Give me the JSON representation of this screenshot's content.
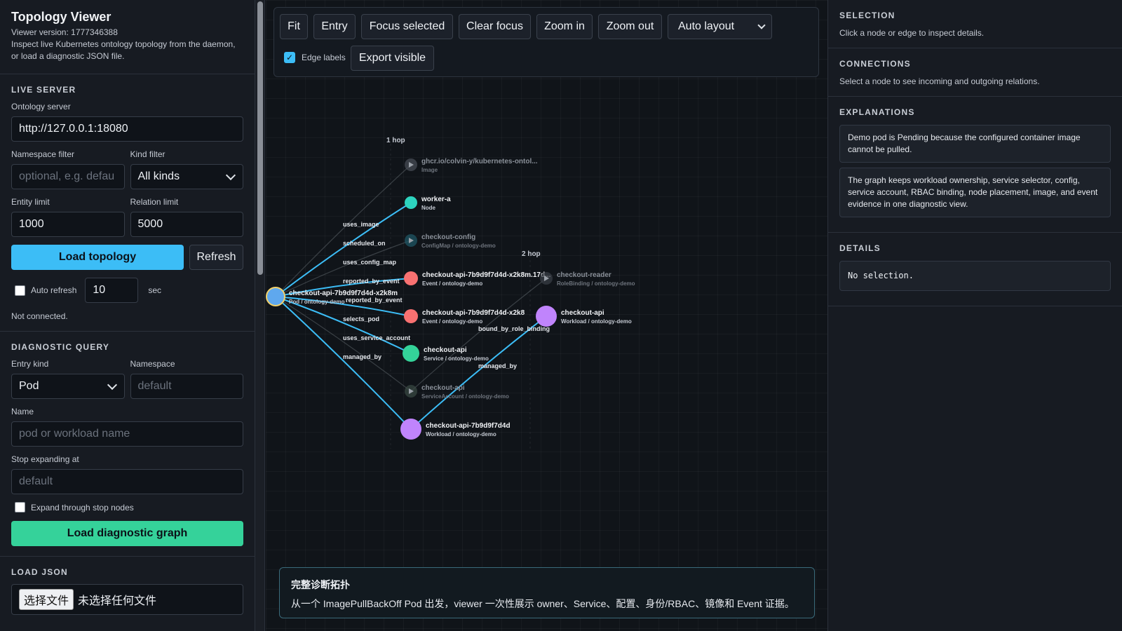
{
  "app": {
    "title": "Topology Viewer",
    "version_line": "Viewer version: 1777346388",
    "description": "Inspect live Kubernetes ontology topology from the daemon, or load a diagnostic JSON file."
  },
  "live_server": {
    "section_title": "LIVE SERVER",
    "server_label": "Ontology server",
    "server_value": "http://127.0.0.1:18080",
    "namespace_label": "Namespace filter",
    "namespace_placeholder": "optional, e.g. defau",
    "kind_label": "Kind filter",
    "kind_value": "All kinds",
    "entity_limit_label": "Entity limit",
    "entity_limit_value": "1000",
    "relation_limit_label": "Relation limit",
    "relation_limit_value": "5000",
    "load_button": "Load topology",
    "refresh_button": "Refresh",
    "auto_refresh_label": "Auto refresh",
    "auto_refresh_value": "10",
    "auto_refresh_unit": "sec",
    "status": "Not connected."
  },
  "diagnostic": {
    "section_title": "DIAGNOSTIC QUERY",
    "entry_kind_label": "Entry kind",
    "entry_kind_value": "Pod",
    "namespace_label": "Namespace",
    "namespace_placeholder": "default",
    "name_label": "Name",
    "name_placeholder": "pod or workload name",
    "stop_label": "Stop expanding at",
    "stop_placeholder": "default",
    "expand_label": "Expand through stop nodes",
    "load_button": "Load diagnostic graph"
  },
  "load_json": {
    "section_title": "LOAD JSON",
    "file_button": "选择文件",
    "file_status": "未选择任何文件"
  },
  "toolbar": {
    "fit": "Fit",
    "entry": "Entry",
    "focus_selected": "Focus selected",
    "clear_focus": "Clear focus",
    "zoom_in": "Zoom in",
    "zoom_out": "Zoom out",
    "layout_value": "Auto layout",
    "edge_labels": "Edge labels",
    "export_visible": "Export visible"
  },
  "graph": {
    "hop_labels": [
      "1 hop",
      "2 hop"
    ],
    "nodes": [
      {
        "id": "pod",
        "name": "checkout-api-7b9d9f7d4d-x2k8m",
        "sub": "Pod / ontology-demo",
        "color": "#5fa8ee",
        "dim": false
      },
      {
        "id": "image",
        "name": "ghcr.io/colvin-y/kubernetes-ontol...",
        "sub": "Image",
        "color": "#4a4f58",
        "dim": true
      },
      {
        "id": "node",
        "name": "worker-a",
        "sub": "Node",
        "color": "#2dd4bf",
        "dim": false
      },
      {
        "id": "cm",
        "name": "checkout-config",
        "sub": "ConfigMap / ontology-demo",
        "color": "#1f5a6a",
        "dim": true
      },
      {
        "id": "ev1",
        "name": "checkout-api-7b9d9f7d4d-x2k8m.17d...",
        "sub": "Event / ontology-demo",
        "color": "#f87171",
        "dim": false
      },
      {
        "id": "ev2",
        "name": "checkout-api-7b9d9f7d4d-x2k8",
        "sub": "Event / ontology-demo",
        "color": "#f87171",
        "dim": false
      },
      {
        "id": "svc",
        "name": "checkout-api",
        "sub": "Service / ontology-demo",
        "color": "#34d399",
        "dim": false
      },
      {
        "id": "sa",
        "name": "checkout-api",
        "sub": "ServiceAccount / ontology-demo",
        "color": "#3a4a44",
        "dim": true
      },
      {
        "id": "rs",
        "name": "checkout-api-7b9d9f7d4d",
        "sub": "Workload / ontology-demo",
        "color": "#c084fc",
        "dim": false
      },
      {
        "id": "rb",
        "name": "checkout-reader",
        "sub": "RoleBinding / ontology-demo",
        "color": "#3b3f47",
        "dim": true
      },
      {
        "id": "deploy",
        "name": "checkout-api",
        "sub": "Workload / ontology-demo",
        "color": "#c084fc",
        "dim": false
      }
    ],
    "edges": [
      {
        "from": "pod",
        "to": "image",
        "label": "uses_image",
        "active": false
      },
      {
        "from": "pod",
        "to": "node",
        "label": "scheduled_on",
        "active": true
      },
      {
        "from": "pod",
        "to": "cm",
        "label": "uses_config_map",
        "active": false
      },
      {
        "from": "pod",
        "to": "ev1",
        "label": "reported_by_event",
        "active": true
      },
      {
        "from": "pod",
        "to": "ev2",
        "label": "reported_by_event",
        "active": true
      },
      {
        "from": "pod",
        "to": "svc",
        "label": "selects_pod",
        "active": true
      },
      {
        "from": "pod",
        "to": "sa",
        "label": "uses_service_account",
        "active": false
      },
      {
        "from": "pod",
        "to": "rs",
        "label": "managed_by",
        "active": true
      },
      {
        "from": "rs",
        "to": "deploy",
        "label": "managed_by",
        "active": true
      },
      {
        "from": "sa",
        "to": "rb",
        "label": "bound_by_role_binding",
        "active": false
      }
    ]
  },
  "caption": {
    "title": "完整诊断拓扑",
    "description": "从一个 ImagePullBackOff Pod 出发，viewer 一次性展示 owner、Service、配置、身份/RBAC、镜像和 Event 证据。"
  },
  "right": {
    "selection_title": "SELECTION",
    "selection_text": "Click a node or edge to inspect details.",
    "connections_title": "CONNECTIONS",
    "connections_text": "Select a node to see incoming and outgoing relations.",
    "explanations_title": "EXPLANATIONS",
    "explanations": [
      "Demo pod is Pending because the configured container image cannot be pulled.",
      "The graph keeps workload ownership, service selector, config, service account, RBAC binding, node placement, image, and event evidence in one diagnostic view."
    ],
    "details_title": "DETAILS",
    "details_text": "No selection."
  },
  "colors": {
    "accent_blue": "#3cbdf6",
    "accent_green": "#35d29a",
    "edge_active": "#3cbdf6"
  }
}
